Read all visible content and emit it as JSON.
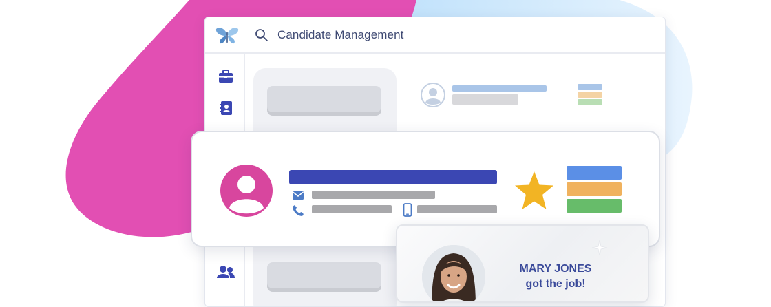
{
  "app": {
    "title": "Candidate Management",
    "logo": "butterfly-logo"
  },
  "search": {
    "icon": "search-icon"
  },
  "sidebar": {
    "items": [
      {
        "icon": "briefcase-icon"
      },
      {
        "icon": "address-book-icon"
      },
      {
        "icon": "users-icon"
      }
    ]
  },
  "candidate_card": {
    "icons": [
      "user-avatar-icon",
      "mail-icon",
      "phone-icon",
      "mobile-icon",
      "star-icon"
    ],
    "rating_starred": true,
    "status_colors": [
      "#5b8fe6",
      "#f0b25e",
      "#67bc6a"
    ]
  },
  "notification": {
    "name": "MARY JONES",
    "message": "got the job!"
  },
  "colors": {
    "accent": "#3b47b3",
    "brand_pink": "#e24fb3",
    "light_blue": "#cfe8fb",
    "star": "#f2b424"
  }
}
